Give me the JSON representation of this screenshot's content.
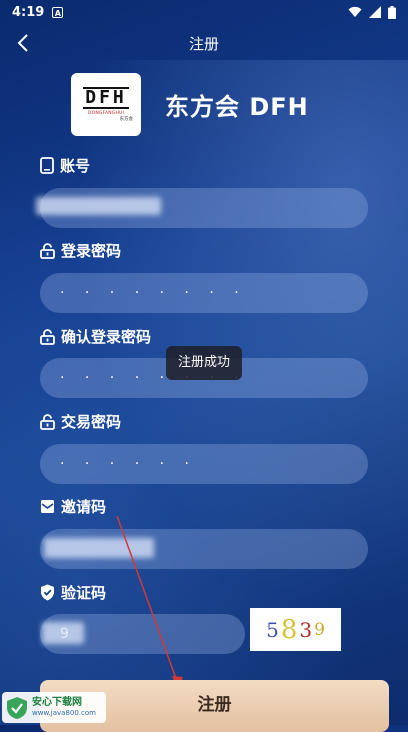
{
  "status_bar": {
    "time": "4:19",
    "app_icon": "A"
  },
  "nav": {
    "title": "注册"
  },
  "brand": {
    "logo_text": "DFH",
    "logo_subtitle": "DONGFANGHUI",
    "logo_subtitle_cn": "东方会",
    "name": "东方会 DFH"
  },
  "fields": {
    "account": {
      "label": "账号",
      "value": ""
    },
    "login_password": {
      "label": "登录密码",
      "value": "· · · · · · · ·"
    },
    "confirm_password": {
      "label": "确认登录密码",
      "value": "· · · · · · · ·"
    },
    "trade_password": {
      "label": "交易密码",
      "value": "· · · · · ·"
    },
    "invite_code": {
      "label": "邀请码",
      "value": ""
    },
    "captcha": {
      "label": "验证码",
      "value": "9",
      "image_chars": [
        "5",
        "8",
        "3",
        "9"
      ]
    }
  },
  "toast": {
    "message": "注册成功"
  },
  "submit": {
    "label": "注册"
  },
  "watermark": {
    "title": "安心下载网",
    "url": "www.java800.com"
  },
  "colors": {
    "captcha_chars": [
      "#3a4fb8",
      "#d8c23a",
      "#b52a2a",
      "#c9a92a"
    ]
  }
}
